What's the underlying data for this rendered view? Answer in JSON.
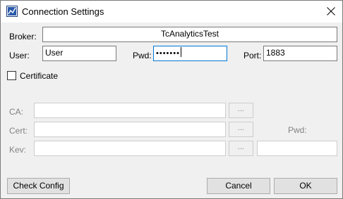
{
  "window": {
    "title": "Connection Settings",
    "close_icon": "close-icon",
    "app_icon": "app-chart-icon"
  },
  "broker": {
    "label": "Broker:",
    "value": "TcAnalyticsTest"
  },
  "user": {
    "label": "User:",
    "value": "User"
  },
  "pwd": {
    "label": "Pwd:",
    "value": "•••••••"
  },
  "port": {
    "label": "Port:",
    "value": "1883"
  },
  "certificate": {
    "label": "Certificate",
    "checked": false
  },
  "cert_section": {
    "ca_label": "CA:",
    "cert_label": "Cert:",
    "key_label": "Kev:",
    "pwd_label": "Pwd:",
    "browse_label": "..."
  },
  "buttons": {
    "check_config": "Check Config",
    "cancel": "Cancel",
    "ok": "OK"
  },
  "colors": {
    "focus_border": "#0078d7",
    "disabled_text": "#838383"
  }
}
